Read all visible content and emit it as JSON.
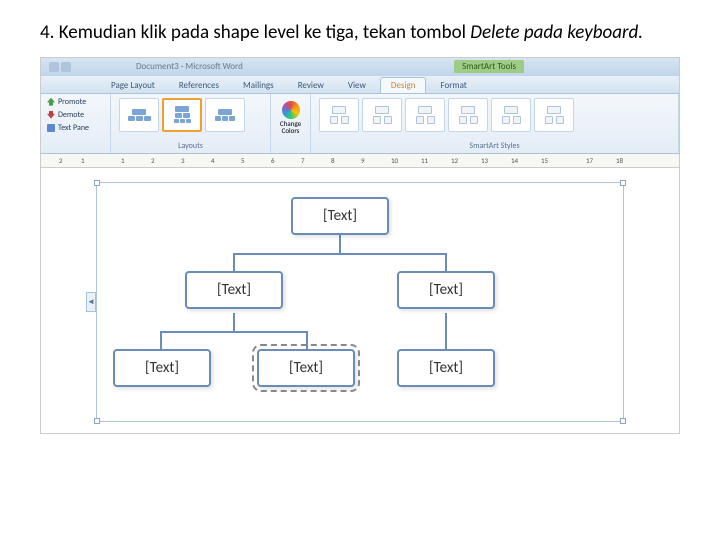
{
  "instruction": {
    "number": "4.",
    "text_a": "Kemudian klik pada shape level ke tiga, tekan tombol ",
    "text_b": "Delete pada keyboard."
  },
  "titlebar": {
    "doc_title": "Document3 - Microsoft Word",
    "tools_label": "SmartArt Tools"
  },
  "tabs": {
    "items": [
      "Page Layout",
      "References",
      "Mailings",
      "Review",
      "View",
      "Design",
      "Format"
    ],
    "active_index": 5
  },
  "ribbon": {
    "side": {
      "promote": "Promote",
      "demote": "Demote",
      "textpane": "Text Pane"
    },
    "layouts_label": "Layouts",
    "colors_label": "Change Colors",
    "styles_label": "SmartArt Styles"
  },
  "ruler": {
    "marks": [
      "2",
      "1",
      "1",
      "2",
      "3",
      "4",
      "5",
      "6",
      "7",
      "8",
      "9",
      "10",
      "11",
      "12",
      "13",
      "14",
      "15",
      "17",
      "18"
    ]
  },
  "org": {
    "text": "[Text]"
  }
}
